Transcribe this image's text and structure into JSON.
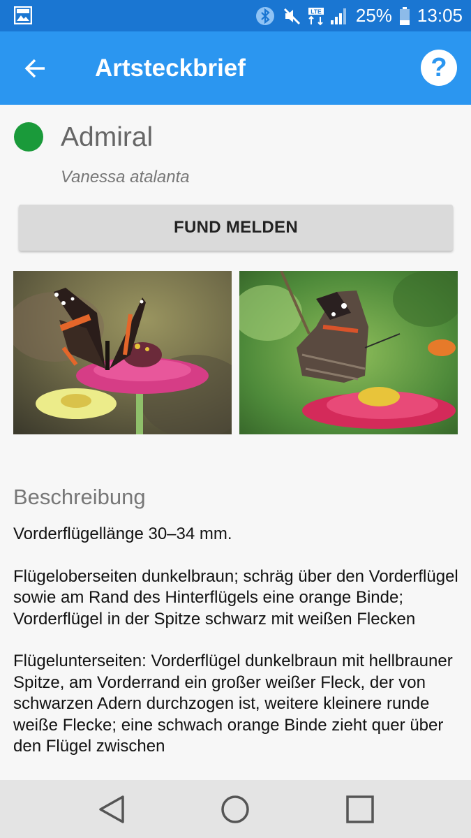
{
  "status_bar": {
    "battery": "25%",
    "time": "13:05",
    "network": "LTE",
    "icons": [
      "gallery-icon",
      "bluetooth-icon",
      "mute-icon",
      "lte-icon",
      "signal-icon",
      "battery-icon"
    ]
  },
  "app_bar": {
    "title": "Artsteckbrief",
    "back_icon": "arrow-left-icon",
    "help_label": "?"
  },
  "species": {
    "name": "Admiral",
    "scientific_name": "Vanessa atalanta",
    "status_color": "#1a9a3a"
  },
  "actions": {
    "report_label": "FUND MELDEN"
  },
  "photos": [
    {
      "subject": "butterfly on pink zinnia"
    },
    {
      "subject": "butterfly underside on red zinnia"
    }
  ],
  "description": {
    "title": "Beschreibung",
    "paragraphs": [
      "Vorderflügellänge 30–34 mm.",
      "Flügeloberseiten dunkelbraun; schräg über den Vorderflügel sowie am Rand des Hinterflügels eine orange Binde; Vorderflügel in der Spitze schwarz mit weißen Flecken",
      "Flügelunterseiten: Vorderflügel dunkelbraun mit hellbrauner Spitze, am Vorderrand ein großer weißer Fleck, der von schwarzen Adern durchzogen ist, weitere kleinere runde weiße Flecke; eine schwach orange Binde zieht quer über den Flügel zwischen"
    ]
  },
  "nav_bar": {
    "icons": [
      "back-triangle-icon",
      "home-circle-icon",
      "recents-square-icon"
    ]
  },
  "colors": {
    "status_bar": "#1a76d2",
    "app_bar": "#2b96f0",
    "button": "#dadada"
  }
}
